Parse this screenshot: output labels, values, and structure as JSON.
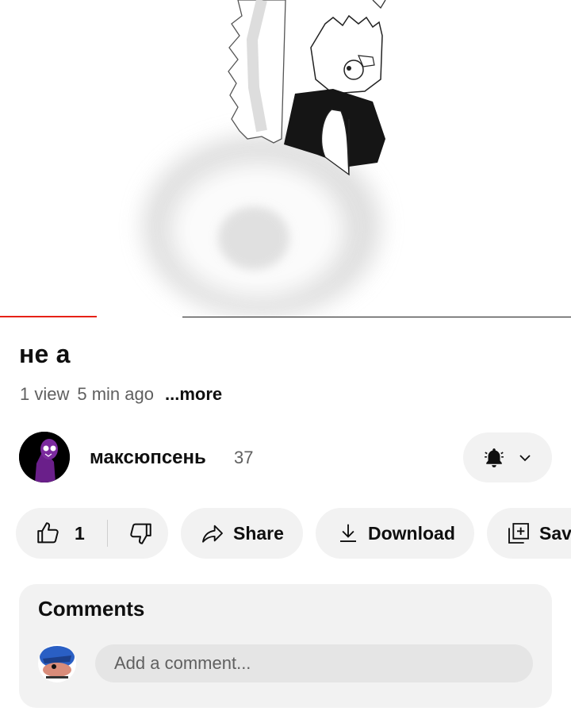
{
  "video": {
    "progress_played_fraction": 0.17,
    "progress_buffered_fraction": 0.32
  },
  "title": "не а",
  "meta": {
    "views": "1 view",
    "age": "5 min ago",
    "more_label": "...more"
  },
  "channel": {
    "name": "максюпсень",
    "subscribers": "37",
    "bell_icon": "bell-icon",
    "chevron_icon": "chevron-down-icon"
  },
  "actions": {
    "like_count": "1",
    "share_label": "Share",
    "download_label": "Download",
    "save_label": "Save"
  },
  "comments": {
    "title": "Comments",
    "placeholder": "Add a comment..."
  },
  "colors": {
    "progress": "#e62117",
    "pill_bg": "#f2f2f2",
    "secondary_text": "#606060"
  }
}
